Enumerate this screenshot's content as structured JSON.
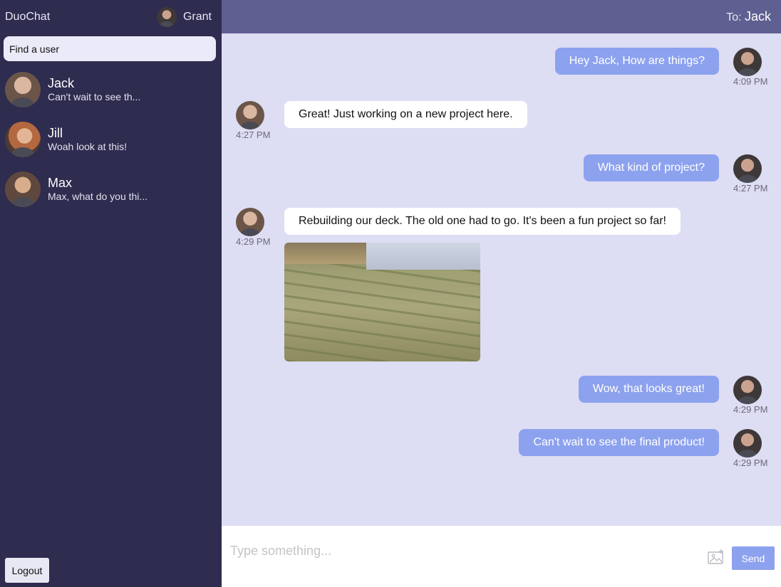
{
  "app": {
    "brand": "DuoChat"
  },
  "current_user": {
    "name": "Grant"
  },
  "search": {
    "placeholder": "Find a user"
  },
  "contacts": [
    {
      "name": "Jack",
      "preview": "Can't wait to see th..."
    },
    {
      "name": "Jill",
      "preview": "Woah look at this!"
    },
    {
      "name": "Max",
      "preview": "Max, what do you thi..."
    }
  ],
  "logout_label": "Logout",
  "header": {
    "to_label": "To:",
    "to_name": "Jack"
  },
  "messages": [
    {
      "direction": "out",
      "text": "Hey Jack, How are things?",
      "time": "4:09 PM"
    },
    {
      "direction": "in",
      "text": "Great! Just working on a new project here.",
      "time": "4:27 PM"
    },
    {
      "direction": "out",
      "text": "What kind of project?",
      "time": "4:27 PM"
    },
    {
      "direction": "in",
      "text": "Rebuilding our deck. The old one had to go. It's been a fun project so far!",
      "time": "4:29 PM",
      "attachment": "deck-photo"
    },
    {
      "direction": "out",
      "text": "Wow, that looks great!",
      "time": "4:29 PM"
    },
    {
      "direction": "out",
      "text": "Can't wait to see the final product!",
      "time": "4:29 PM"
    }
  ],
  "composer": {
    "placeholder": "Type something...",
    "send_label": "Send",
    "image_icon": "image-upload-icon"
  },
  "colors": {
    "sidebar": "#2e2c4f",
    "header": "#5f5f91",
    "chat_bg": "#ddddf4",
    "outgoing_bubble": "#8da2ee",
    "incoming_bubble": "#ffffff"
  }
}
